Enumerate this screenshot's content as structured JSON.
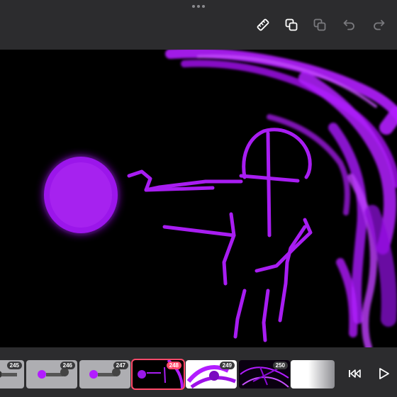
{
  "toolbar": {
    "icons": [
      "ruler-icon",
      "duplicate-layer-icon",
      "layers-icon",
      "undo-icon",
      "redo-icon"
    ]
  },
  "colors": {
    "toolbar_bg": "#2c2c2e",
    "canvas_bg": "#000000",
    "brush_purple": "#b21cff",
    "selected_frame_border": "#ff4a6a"
  },
  "timeline": {
    "frames": [
      {
        "number": "245"
      },
      {
        "number": "246"
      },
      {
        "number": "247"
      },
      {
        "number": "248",
        "selected": true
      },
      {
        "number": "249"
      },
      {
        "number": "250"
      },
      {
        "number": ""
      }
    ],
    "controls": [
      "skip-to-start-icon",
      "play-icon"
    ]
  }
}
